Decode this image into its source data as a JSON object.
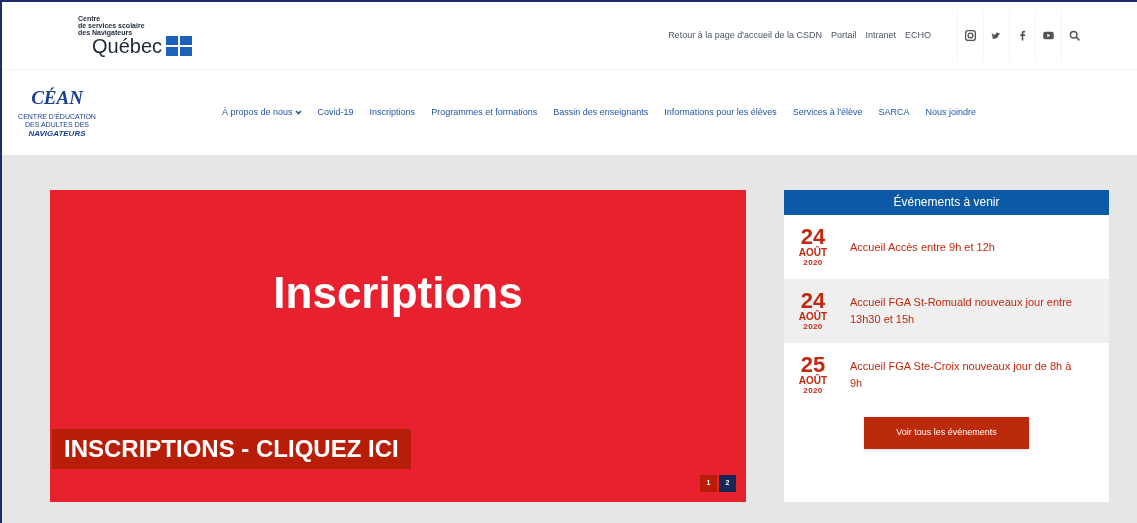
{
  "brand": {
    "org_lines": [
      "Centre",
      "de services scolaire",
      "des Navigateurs"
    ],
    "province": "Québec"
  },
  "top_links": [
    "Retour à la page d'accueil de la CSDN",
    "Portail",
    "Intranet",
    "ECHO"
  ],
  "social_icons": [
    {
      "kind": "instagram"
    },
    {
      "kind": "twitter"
    },
    {
      "kind": "facebook"
    },
    {
      "kind": "youtube"
    },
    {
      "kind": "search"
    }
  ],
  "school_logo": {
    "acronym": "CÉAN",
    "line_1": "CENTRE D'ÉDUCATION",
    "line_2": "DES ADULTES DES",
    "line_3": "NAVIGATEURS"
  },
  "nav": [
    {
      "label": "À propos de nous",
      "dropdown": true
    },
    {
      "label": "Covid-19",
      "dropdown": false
    },
    {
      "label": "Inscriptions",
      "dropdown": false
    },
    {
      "label": "Programmes et formations",
      "dropdown": false
    },
    {
      "label": "Bassin des enseignants",
      "dropdown": false
    },
    {
      "label": "Informations pour les élèves",
      "dropdown": false
    },
    {
      "label": "Services à l'élève",
      "dropdown": false
    },
    {
      "label": "SARCA",
      "dropdown": false
    },
    {
      "label": "Nous joindre",
      "dropdown": false
    }
  ],
  "slide": {
    "title": "Inscriptions",
    "caption": "INSCRIPTIONS - CLIQUEZ ICI",
    "pages": [
      {
        "label": "1",
        "selected": false
      },
      {
        "label": "2",
        "selected": true
      }
    ]
  },
  "events": {
    "title": "Événements à venir",
    "items": [
      {
        "day": "24",
        "month": "AOÛT",
        "year": "2020",
        "text": "Accueil Accès entre 9h et 12h"
      },
      {
        "day": "24",
        "month": "AOÛT",
        "year": "2020",
        "text": "Accueil FGA St-Romuald nouveaux jour entre 13h30 et 15h"
      },
      {
        "day": "25",
        "month": "AOÛT",
        "year": "2020",
        "text": "Accueil FGA Ste-Croix nouveaux jour de 8h à 9h"
      }
    ],
    "button": "Voir tous les événements"
  }
}
